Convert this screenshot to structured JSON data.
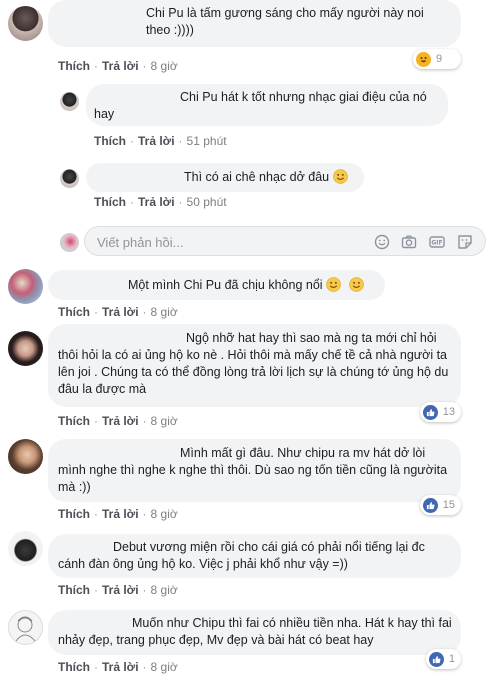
{
  "comments": [
    {
      "text": "Chi Pu là tấm gương sáng cho mấy người này noi theo :))))",
      "like": "Thích",
      "reply": "Trả lời",
      "time": "8 giờ",
      "reaction_count": "9"
    },
    {
      "text": "Chi Pu hát k tốt nhưng nhạc giai điệu của nó hay",
      "like": "Thích",
      "reply": "Trả lời",
      "time": "51 phút"
    },
    {
      "text": "Thì có ai chê nhạc dở đâu",
      "like": "Thích",
      "reply": "Trả lời",
      "time": "50 phút"
    },
    {
      "text": "Một mình Chi Pu đã chịu không nổi",
      "like": "Thích",
      "reply": "Trả lời",
      "time": "8 giờ"
    },
    {
      "text": "Ngộ nhỡ hat hay thì sao mà ng ta mới chỉ hỏi thôi hỏi la có ai ủng hộ ko nè . Hỏi thôi mà mấy chế tề cả nhà người ta lên joi . Chúng ta có thể đồng lòng trả lời lịch sự là chúng tớ ủng hộ du đâu la được mà",
      "like": "Thích",
      "reply": "Trả lời",
      "time": "8 giờ",
      "reaction_count": "13"
    },
    {
      "text": "Mình mất gì đâu. Như chipu ra mv hát dở lòi mình nghe thì nghe k nghe thì thôi. Dù sao ng tốn tiền cũng là ngườita mà :))",
      "like": "Thích",
      "reply": "Trả lời",
      "time": "8 giờ",
      "reaction_count": "15"
    },
    {
      "text": "Debut vương miện rồi cho cái giá có phải nổi tiếng lại đc cánh đàn ông ủng hộ ko. Việc j phải khổ như vậy =))",
      "like": "Thích",
      "reply": "Trả lời",
      "time": "8 giờ"
    },
    {
      "text": "Muốn như Chipu thì fai có nhiều tiền nha. Hát k hay thì fai nhảy đẹp, trang phục đẹp, Mv đẹp và bài hát có beat hay",
      "like": "Thích",
      "reply": "Trả lời",
      "time": "8 giờ",
      "reaction_count": "1"
    }
  ],
  "reply_box": {
    "placeholder": "Viết phản hồi..."
  },
  "icons": {
    "reply_box_tools": [
      "emoji-icon",
      "camera-icon",
      "gif-icon",
      "sticker-icon"
    ],
    "reactions": [
      "haha",
      "like"
    ]
  },
  "colors": {
    "bubble": "#f2f3f5",
    "like_blue": "#4267b2",
    "text": "#1c1e21",
    "meta": "#90949c"
  }
}
